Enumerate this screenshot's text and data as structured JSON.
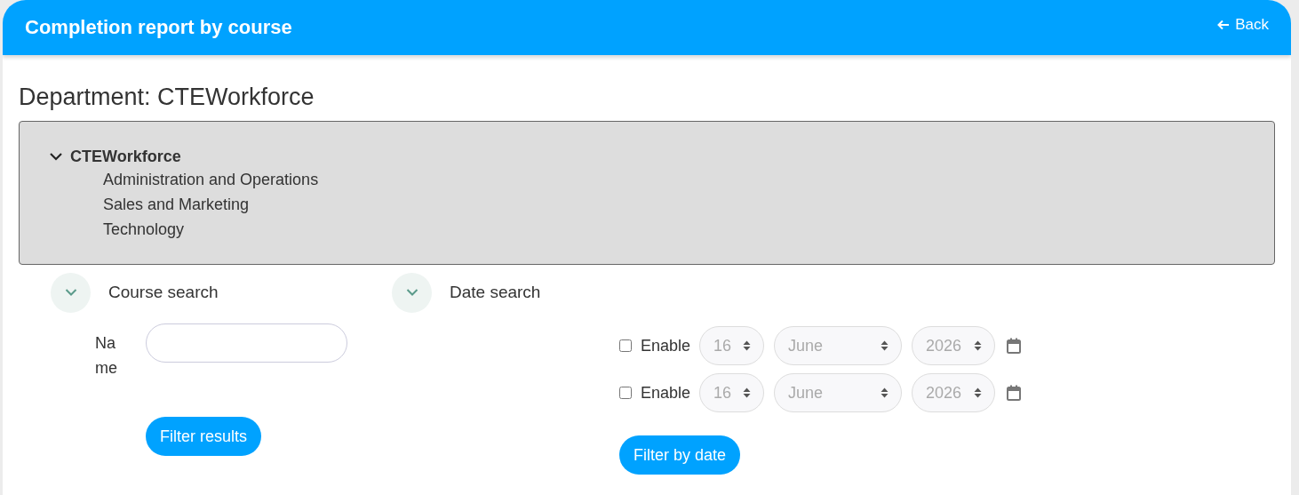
{
  "header": {
    "title": "Completion report by course",
    "back_link": "Back"
  },
  "department_heading": "Department: CTEWorkforce",
  "tree": {
    "label": "CTEWorkforce",
    "expanded": true,
    "children": [
      {
        "label": "Administration and Operations"
      },
      {
        "label": "Sales and Marketing"
      },
      {
        "label": "Technology"
      }
    ]
  },
  "course_search": {
    "title": "Course search",
    "expanded": true,
    "name_label": "Name",
    "button": "Filter results"
  },
  "date_search": {
    "title": "Date search",
    "expanded": true,
    "rows": [
      {
        "enable_label": "Enable",
        "checked": false,
        "day": "16",
        "month": "June",
        "year": "2026"
      },
      {
        "enable_label": "Enable",
        "checked": false,
        "day": "16",
        "month": "June",
        "year": "2026"
      }
    ],
    "button": "Filter by date"
  }
}
